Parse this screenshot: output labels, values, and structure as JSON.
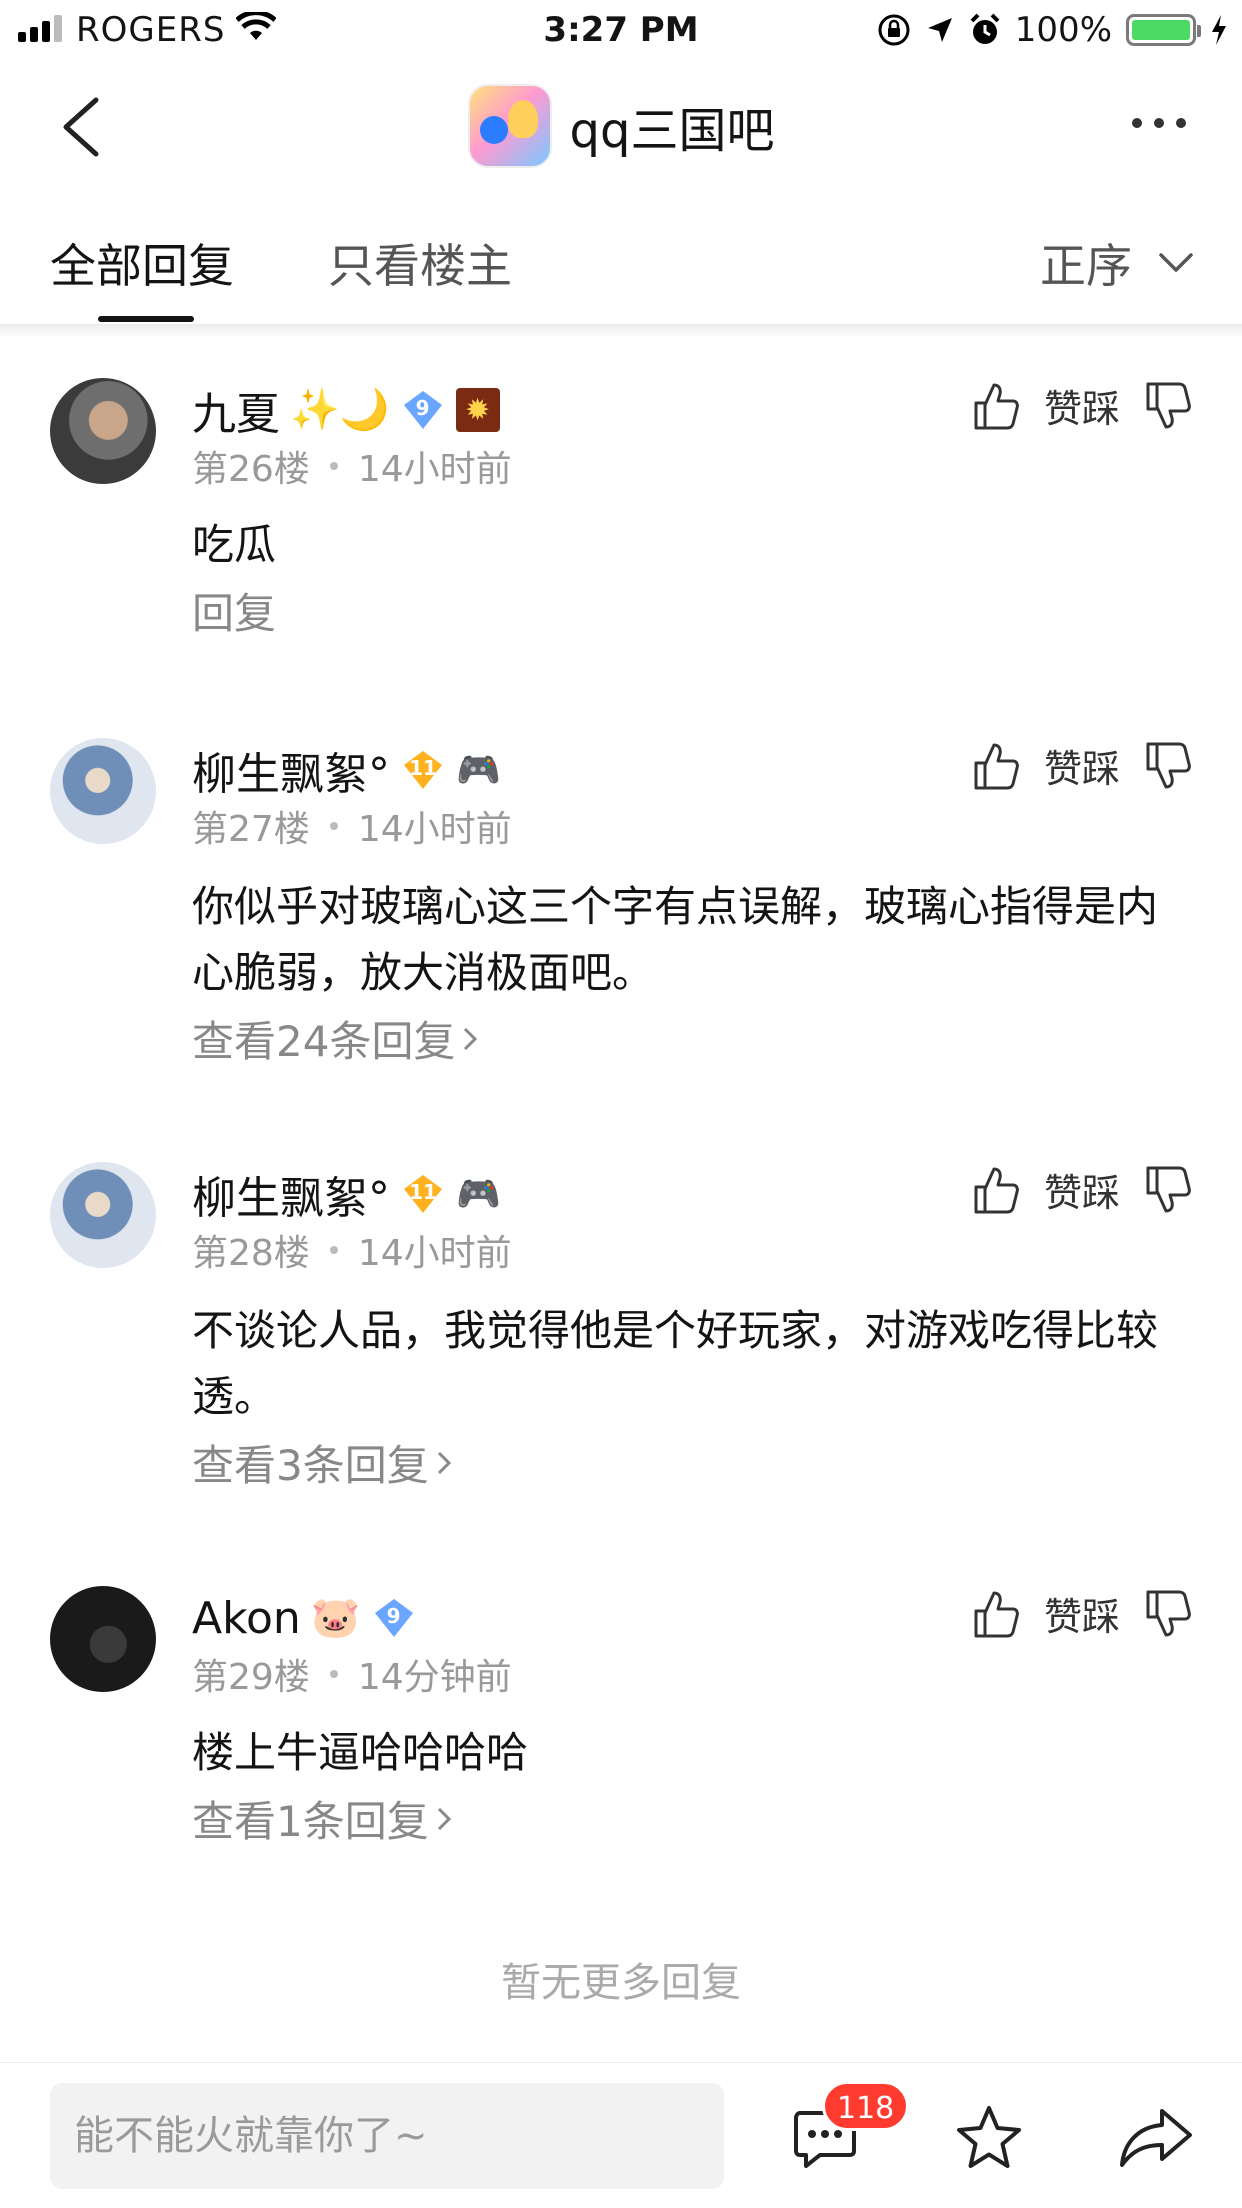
{
  "status_bar": {
    "carrier": "ROGERS",
    "time": "3:27 PM",
    "battery_pct": "100%",
    "battery_color": "#4cd964"
  },
  "nav": {
    "forum_name": "qq三国吧",
    "back_icon": "chevron-left-icon",
    "more_icon": "more-dots-icon"
  },
  "tabs": {
    "all_label": "全部回复",
    "owner_label": "只看楼主",
    "sort_label": "正序"
  },
  "replies": [
    {
      "username": "九夏",
      "emojis": "✨🌙",
      "level": "9",
      "floor": "第26楼",
      "time": "14小时前",
      "content": "吃瓜",
      "sub_link": "回复",
      "zancai": "赞踩"
    },
    {
      "username": "柳生飘絮°",
      "emojis": "",
      "level": "11",
      "floor": "第27楼",
      "time": "14小时前",
      "content": "你似乎对玻璃心这三个字有点误解，玻璃心指得是内心脆弱，放大消极面吧。",
      "sub_link": "查看24条回复",
      "zancai": "赞踩"
    },
    {
      "username": "柳生飘絮°",
      "emojis": "",
      "level": "11",
      "floor": "第28楼",
      "time": "14小时前",
      "content": "不谈论人品，我觉得他是个好玩家，对游戏吃得比较透。",
      "sub_link": "查看3条回复",
      "zancai": "赞踩"
    },
    {
      "username": "Akon",
      "emojis": "🐷",
      "level": "9",
      "floor": "第29楼",
      "time": "14分钟前",
      "content": "楼上牛逼哈哈哈哈",
      "sub_link": "查看1条回复",
      "zancai": "赞踩"
    }
  ],
  "no_more": "暂无更多回复",
  "bottom": {
    "placeholder": "能不能火就靠你了~",
    "message_count": "118",
    "badge_color": "#ff3b30"
  }
}
